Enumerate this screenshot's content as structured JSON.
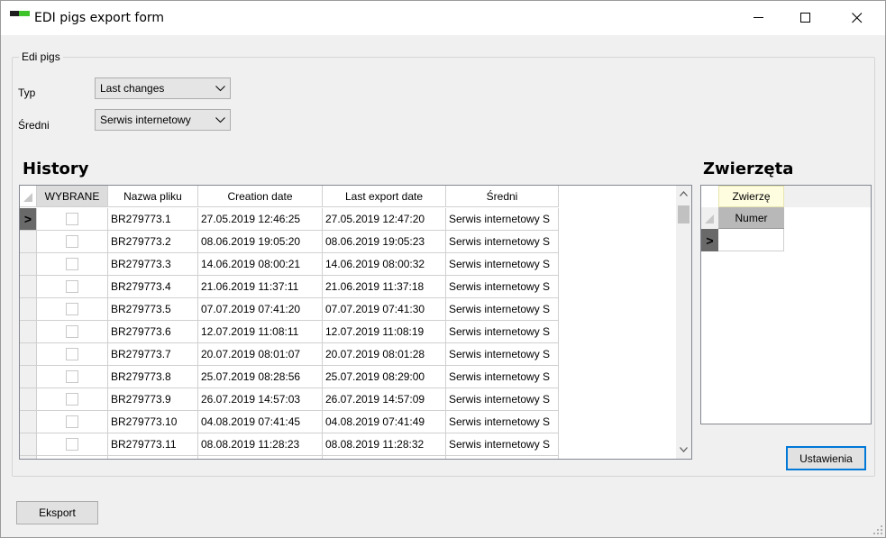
{
  "window": {
    "title": "EDI pigs export form"
  },
  "group": {
    "legend": "Edi pigs",
    "typ_label": "Typ",
    "typ_value": "Last changes",
    "sredni_label": "Średni",
    "sredni_value": "Serwis internetowy"
  },
  "history": {
    "heading": "History",
    "columns": [
      "WYBRANE",
      "Nazwa pliku",
      "Creation date",
      "Last export date",
      "Średni"
    ],
    "rows": [
      {
        "file": "BR279773.1",
        "created": "27.05.2019 12:46:25",
        "exported": "27.05.2019 12:47:20",
        "medium": "Serwis internetowy S"
      },
      {
        "file": "BR279773.2",
        "created": "08.06.2019 19:05:20",
        "exported": "08.06.2019 19:05:23",
        "medium": "Serwis internetowy S"
      },
      {
        "file": "BR279773.3",
        "created": "14.06.2019 08:00:21",
        "exported": "14.06.2019 08:00:32",
        "medium": "Serwis internetowy S"
      },
      {
        "file": "BR279773.4",
        "created": "21.06.2019 11:37:11",
        "exported": "21.06.2019 11:37:18",
        "medium": "Serwis internetowy S"
      },
      {
        "file": "BR279773.5",
        "created": "07.07.2019 07:41:20",
        "exported": "07.07.2019 07:41:30",
        "medium": "Serwis internetowy S"
      },
      {
        "file": "BR279773.6",
        "created": "12.07.2019 11:08:11",
        "exported": "12.07.2019 11:08:19",
        "medium": "Serwis internetowy S"
      },
      {
        "file": "BR279773.7",
        "created": "20.07.2019 08:01:07",
        "exported": "20.07.2019 08:01:28",
        "medium": "Serwis internetowy S"
      },
      {
        "file": "BR279773.8",
        "created": "25.07.2019 08:28:56",
        "exported": "25.07.2019 08:29:00",
        "medium": "Serwis internetowy S"
      },
      {
        "file": "BR279773.9",
        "created": "26.07.2019 14:57:03",
        "exported": "26.07.2019 14:57:09",
        "medium": "Serwis internetowy S"
      },
      {
        "file": "BR279773.10",
        "created": "04.08.2019 07:41:45",
        "exported": "04.08.2019 07:41:49",
        "medium": "Serwis internetowy S"
      },
      {
        "file": "BR279773.11",
        "created": "08.08.2019 11:28:23",
        "exported": "08.08.2019 11:28:32",
        "medium": "Serwis internetowy S"
      }
    ],
    "current_row_marker": ">"
  },
  "animals": {
    "heading": "Zwierzęta",
    "band_header": "Zwierzę",
    "column": "Numer",
    "current_row_marker": ">"
  },
  "buttons": {
    "settings": "Ustawienia",
    "export": "Eksport"
  }
}
